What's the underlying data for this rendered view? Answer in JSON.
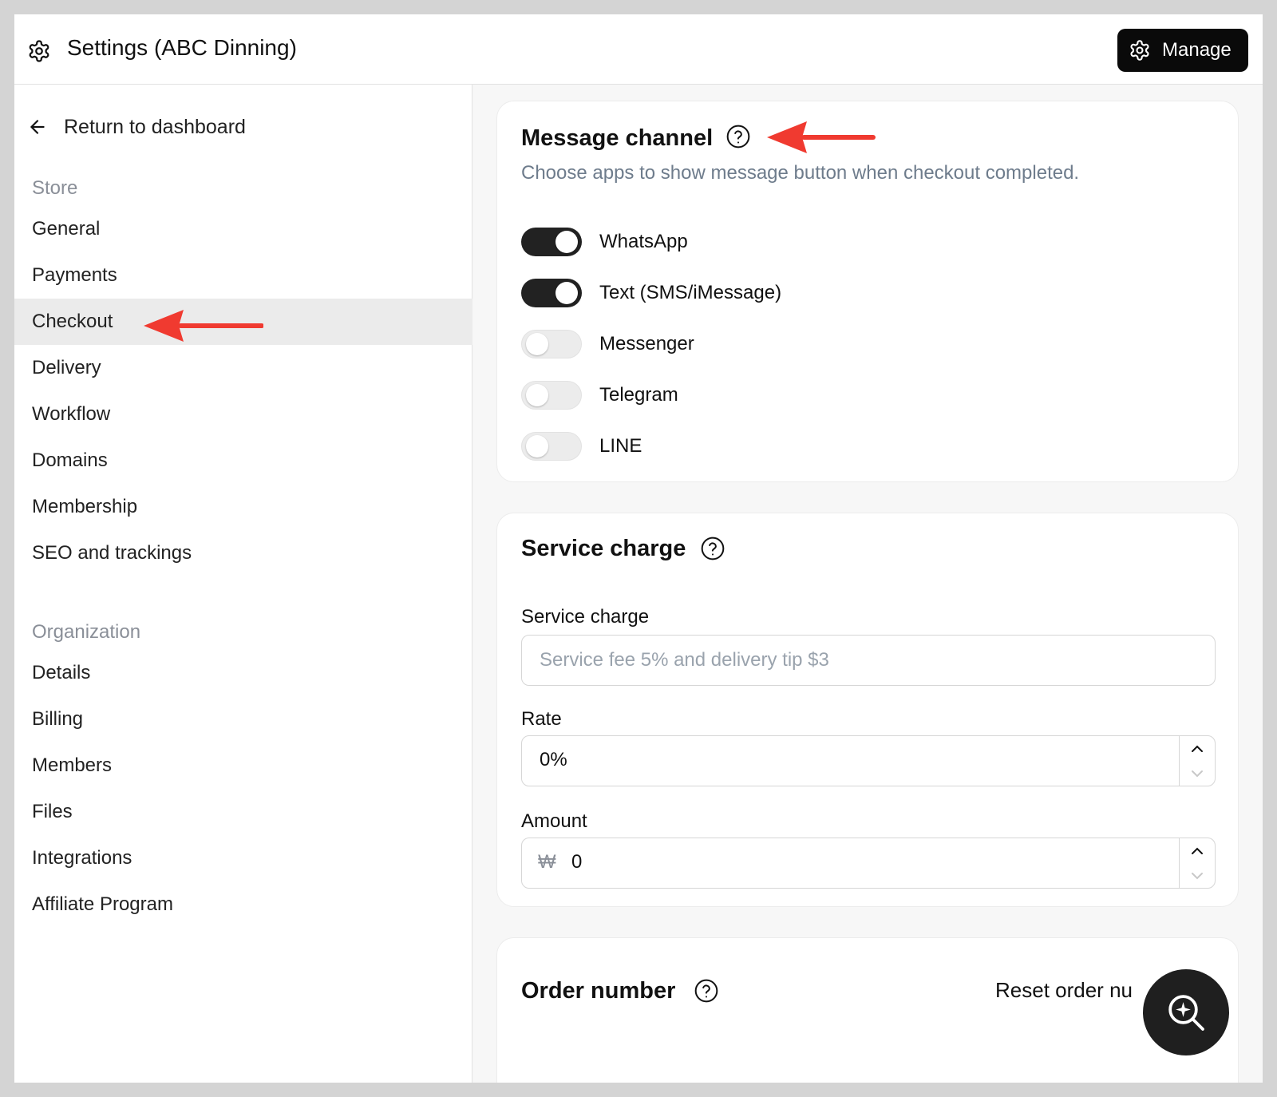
{
  "header": {
    "title": "Settings (ABC Dinning)",
    "manage_label": "Manage"
  },
  "sidebar": {
    "back_label": "Return to dashboard",
    "store_title": "Store",
    "store_items": [
      "General",
      "Payments",
      "Checkout",
      "Delivery",
      "Workflow",
      "Domains",
      "Membership",
      "SEO and trackings"
    ],
    "active_item": "Checkout",
    "org_title": "Organization",
    "org_items": [
      "Details",
      "Billing",
      "Members",
      "Files",
      "Integrations",
      "Affiliate Program"
    ]
  },
  "message_channel": {
    "title": "Message channel",
    "subtitle": "Choose apps to show message button when checkout completed.",
    "channels": [
      {
        "label": "WhatsApp",
        "enabled": true
      },
      {
        "label": "Text (SMS/iMessage)",
        "enabled": true
      },
      {
        "label": "Messenger",
        "enabled": false
      },
      {
        "label": "Telegram",
        "enabled": false
      },
      {
        "label": "LINE",
        "enabled": false
      }
    ]
  },
  "service_charge": {
    "title": "Service charge",
    "field_label": "Service charge",
    "field_placeholder": "Service fee 5% and delivery tip $3",
    "rate_label": "Rate",
    "rate_value": "0%",
    "amount_label": "Amount",
    "currency_symbol": "₩",
    "amount_value": "0"
  },
  "order_number": {
    "title": "Order number",
    "reset_label": "Reset order nu"
  },
  "colors": {
    "annotation_arrow": "#f03a30",
    "toggle_on": "#222222",
    "manage_button": "#0a0a0a"
  }
}
